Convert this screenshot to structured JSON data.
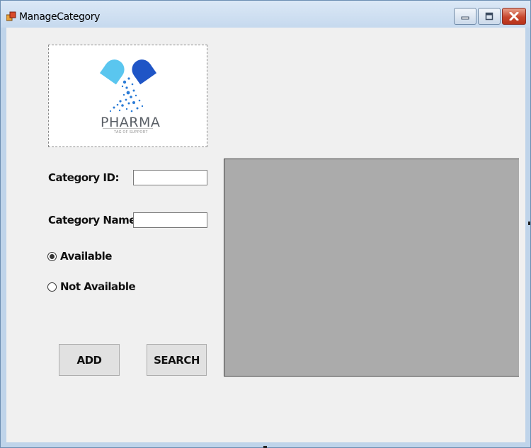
{
  "window": {
    "title": "ManageCategory",
    "icon": "form-app-icon",
    "controls": [
      "minimize-icon",
      "maximize-icon",
      "close-icon"
    ]
  },
  "logo": {
    "name": "PHARMA",
    "tagline": "TAG OF SUPPORT",
    "colors": {
      "capsule_light": "#5ac6ef",
      "capsule_dark": "#1f55c6",
      "dots": "#2a7bd6"
    }
  },
  "form": {
    "category_id_label": "Category ID:",
    "category_id_value": "",
    "category_name_label": "Category Name:",
    "category_name_value": "",
    "radio_available": "Available",
    "radio_not_available": "Not Available",
    "selected": "Available"
  },
  "buttons": {
    "add": "ADD",
    "search": "SEARCH"
  },
  "colors": {
    "client_bg": "#f0f0f0",
    "grid_bg": "#ababab",
    "close_button": "#c7472e"
  }
}
